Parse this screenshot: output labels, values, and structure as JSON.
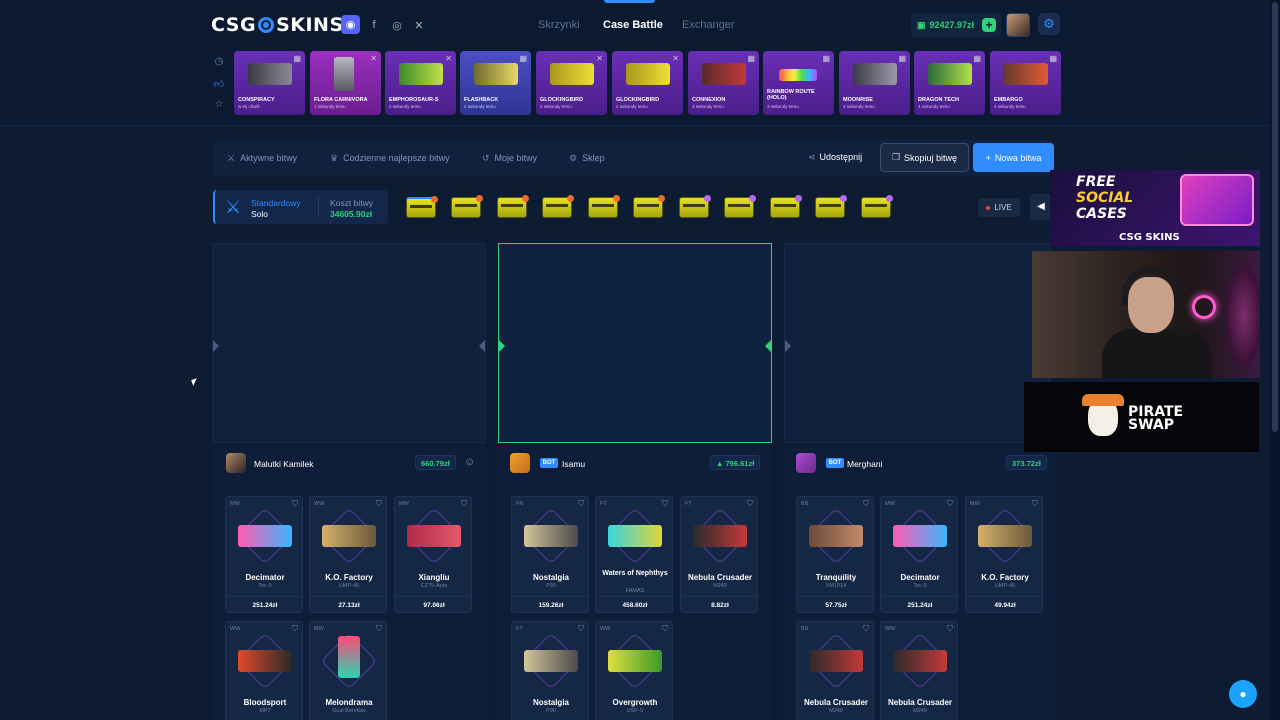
{
  "brand": {
    "name_left": "CSG",
    "name_right": "SKINS"
  },
  "nav": {
    "tabs": [
      {
        "label": "Skrzynki"
      },
      {
        "label": "Case Battle"
      },
      {
        "label": "Exchanger"
      }
    ]
  },
  "user": {
    "balance": "92427.97zł"
  },
  "live_drops": [
    {
      "name": "CONSPIRACY",
      "sub": "w tej chwili"
    },
    {
      "name": "FLORA CARNIVORA",
      "sub": "1 sekundy temu"
    },
    {
      "name": "EMPHOROSAUR-S",
      "sub": "2 sekundy temu"
    },
    {
      "name": "FLASHBACK",
      "sub": "2 sekundy temu"
    },
    {
      "name": "GLOCKINGBIRD",
      "sub": "2 sekundy temu"
    },
    {
      "name": "GLOCKINGBIRD",
      "sub": "2 sekundy temu"
    },
    {
      "name": "CONNEXION",
      "sub": "3 sekundy temu"
    },
    {
      "name": "RAINBOW ROUTE (HOLO)",
      "sub": "3 sekundy temu"
    },
    {
      "name": "MOONRISE",
      "sub": "4 sekundy temu"
    },
    {
      "name": "DRAGON TECH",
      "sub": "4 sekundy temu"
    },
    {
      "name": "EMBARGO",
      "sub": "4 sekundy temu"
    }
  ],
  "subnav": {
    "active": "Aktywne bitwy",
    "best": "Codzienne najlepsze bitwy",
    "mine": "Moje bitwy",
    "shop": "Sklep",
    "share": "Udostępnij",
    "copy": "Skopiuj bitwę",
    "new": "Nowa bitwa"
  },
  "battle": {
    "mode": "Standardowy",
    "type": "Solo",
    "cost_label": "Koszt bitwy",
    "cost": "34605.90zł",
    "live": "LIVE"
  },
  "ads": {
    "social_1": "FREE",
    "social_2": "SOCIAL",
    "social_3": "CASES",
    "brand": "CSG SKINS",
    "pirate_1": "PIRATE",
    "pirate_2": "SWAP"
  },
  "players": [
    {
      "name": "Malutki Kamilek",
      "total": "660.79zł",
      "items": [
        {
          "wear": "MW",
          "name": "Decimator",
          "skin": "Tec-9",
          "price": "251.24zł"
        },
        {
          "wear": "WW",
          "name": "K.O. Factory",
          "skin": "UMP-45",
          "price": "27.13zł"
        },
        {
          "wear": "MW",
          "name": "Xiangliu",
          "skin": "CZ75-Auto",
          "price": "97.06zł"
        },
        {
          "wear": "WW",
          "name": "Bloodsport",
          "skin": "MP7",
          "price": ""
        },
        {
          "wear": "MW",
          "name": "Melondrama",
          "skin": "Dual Berettas",
          "price": ""
        }
      ]
    },
    {
      "name": "Isamu",
      "bot": "BOT",
      "total": "796.61zł",
      "items": [
        {
          "wear": "FN",
          "name": "Nostalgia",
          "skin": "P90",
          "price": "159.26zł"
        },
        {
          "wear": "FT",
          "name": "Waters of Nephthys",
          "skin": "FAMAS",
          "price": "458.60zł"
        },
        {
          "wear": "FT",
          "name": "Nebula Crusader",
          "skin": "M249",
          "price": "8.82zł"
        },
        {
          "wear": "FT",
          "name": "Nostalgia",
          "skin": "P90",
          "price": ""
        },
        {
          "wear": "WW",
          "name": "Overgrowth",
          "skin": "USP-S",
          "price": ""
        }
      ]
    },
    {
      "name": "Merghani",
      "bot": "BOT",
      "total": "373.72zł",
      "items": [
        {
          "wear": "BS",
          "name": "Tranquility",
          "skin": "XM1014",
          "price": "57.75zł"
        },
        {
          "wear": "MW",
          "name": "Decimator",
          "skin": "Tec-9",
          "price": "251.24zł"
        },
        {
          "wear": "MW",
          "name": "K.O. Factory",
          "skin": "UMP-45",
          "price": "49.94zł"
        },
        {
          "wear": "BS",
          "name": "Nebula Crusader",
          "skin": "M249",
          "price": ""
        },
        {
          "wear": "WW",
          "name": "Nebula Crusader",
          "skin": "M249",
          "price": ""
        }
      ]
    }
  ]
}
